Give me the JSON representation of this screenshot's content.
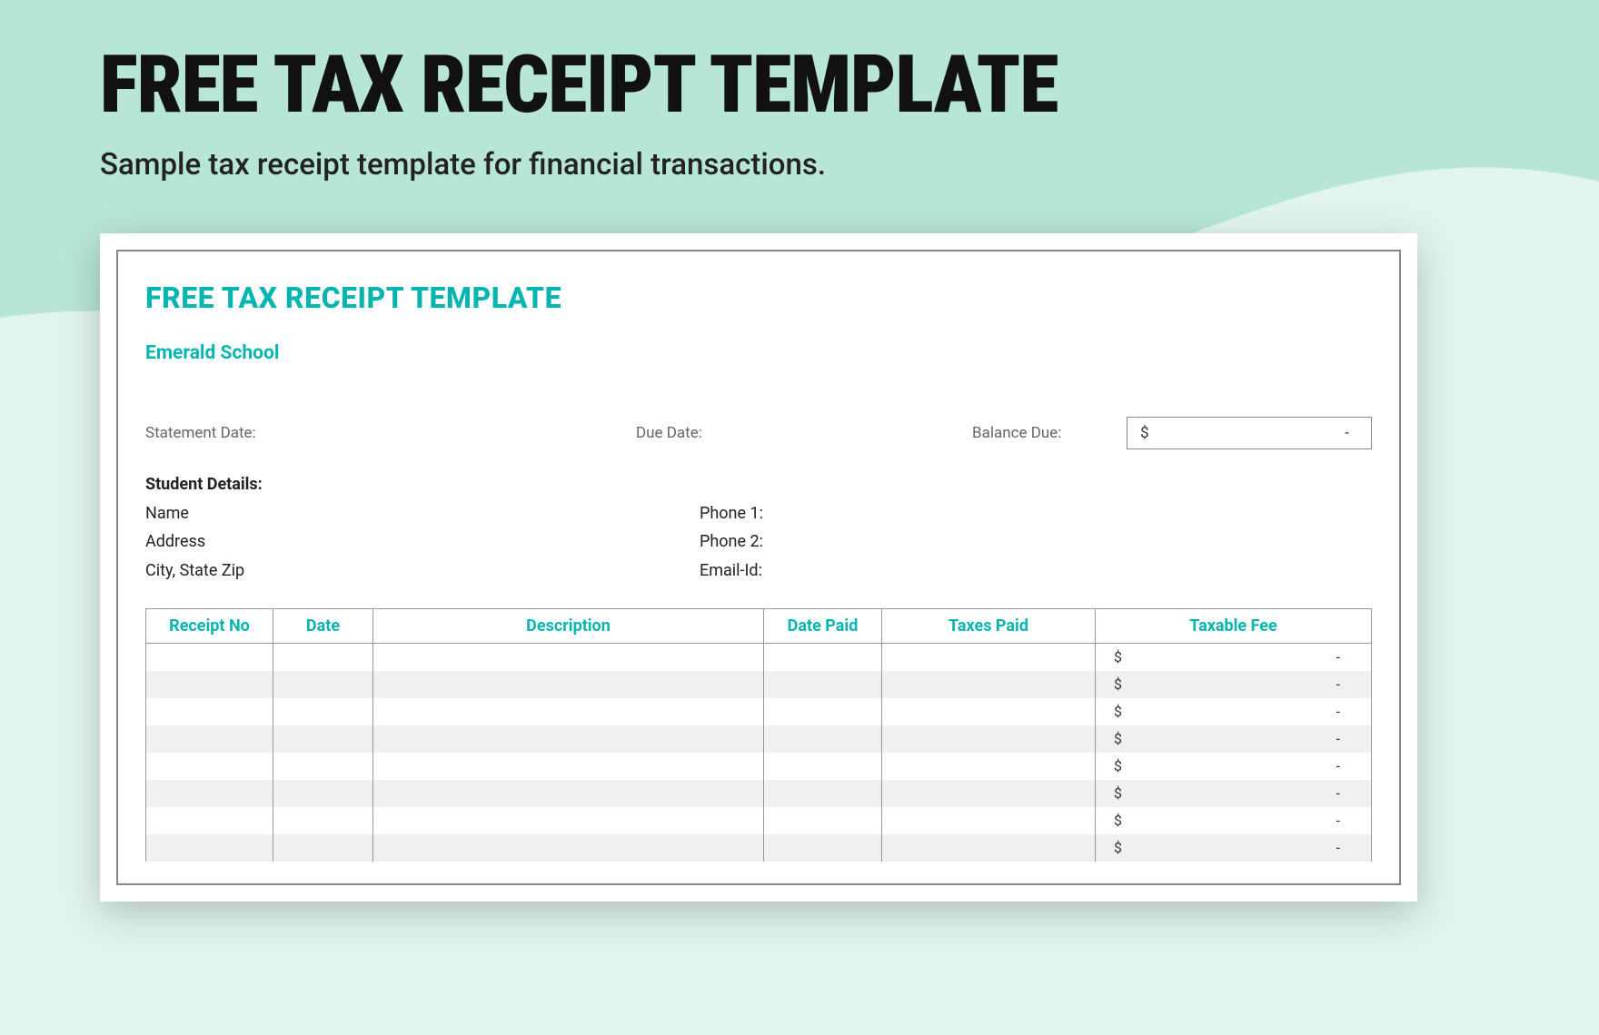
{
  "header": {
    "title": "FREE TAX RECEIPT TEMPLATE",
    "subtitle": "Sample tax receipt template for financial transactions."
  },
  "document": {
    "title": "FREE TAX RECEIPT TEMPLATE",
    "org_name": "Emerald School",
    "meta": {
      "statement_date_label": "Statement Date:",
      "due_date_label": "Due Date:",
      "balance_due_label": "Balance Due:",
      "balance_currency": "$",
      "balance_value": "-"
    },
    "student": {
      "heading": "Student Details:",
      "left": [
        "Name",
        "Address",
        "City, State Zip"
      ],
      "right": [
        "Phone 1:",
        "Phone 2:",
        "Email-Id:"
      ]
    },
    "table": {
      "headers": [
        "Receipt No",
        "Date",
        "Description",
        "Date Paid",
        "Taxes Paid",
        "Taxable Fee"
      ],
      "fee_currency": "$",
      "fee_placeholder": "-",
      "row_count": 8
    }
  }
}
